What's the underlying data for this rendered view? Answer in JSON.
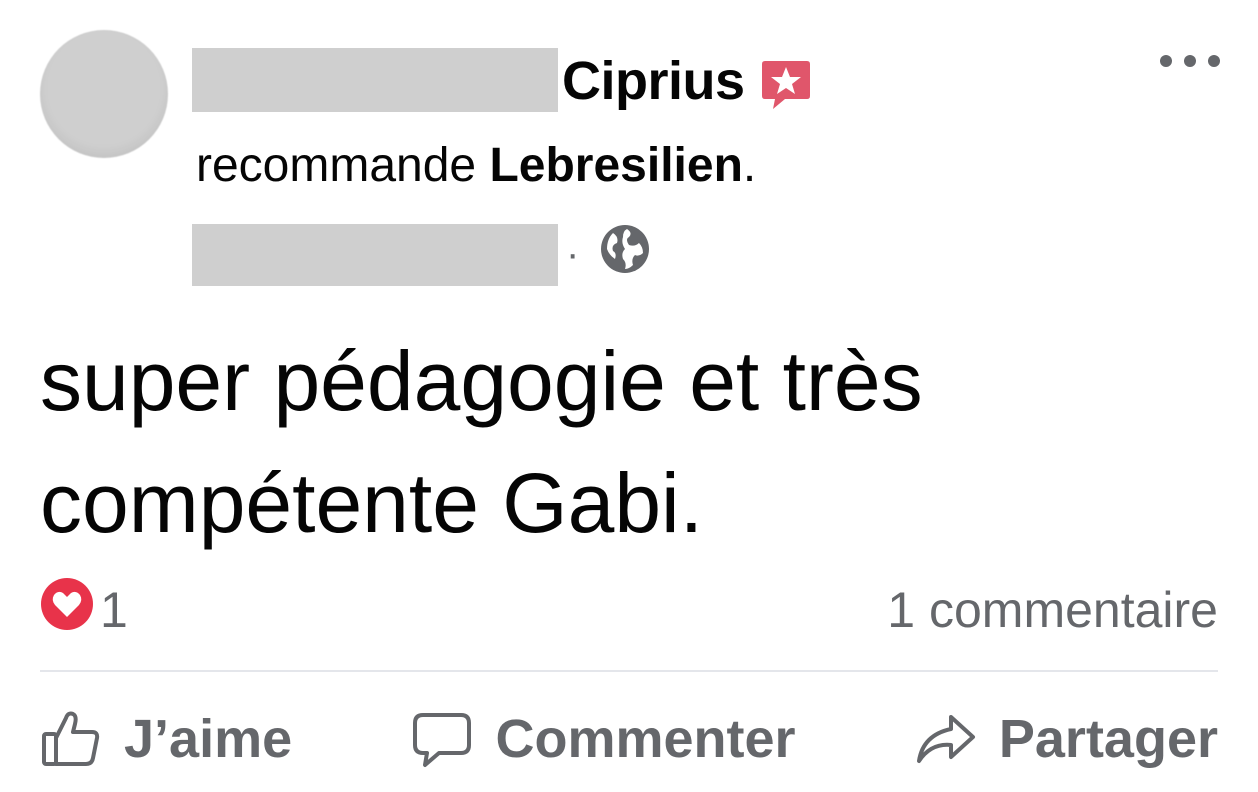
{
  "post": {
    "author_name": "Ciprius",
    "author_badge_icon": "star-speech-bubble-icon",
    "verb": "recommande",
    "page_name": "Lebresilien",
    "page_suffix": ".",
    "meta_separator": "·",
    "privacy_icon": "globe-icon",
    "more_icon": "more-options-icon",
    "text": "super pédagogie et très compétente Gabi."
  },
  "stats": {
    "reaction_icon": "love-reaction-icon",
    "reaction_count": "1",
    "comment_count_label": "1 commentaire"
  },
  "actions": {
    "like_label": "J’aime",
    "comment_label": "Commenter",
    "share_label": "Partager"
  },
  "colors": {
    "text_primary": "#050505",
    "text_secondary": "#65676b",
    "badge": "#e0566b",
    "love": "#e8334a",
    "redaction": "#cfcfcf"
  }
}
